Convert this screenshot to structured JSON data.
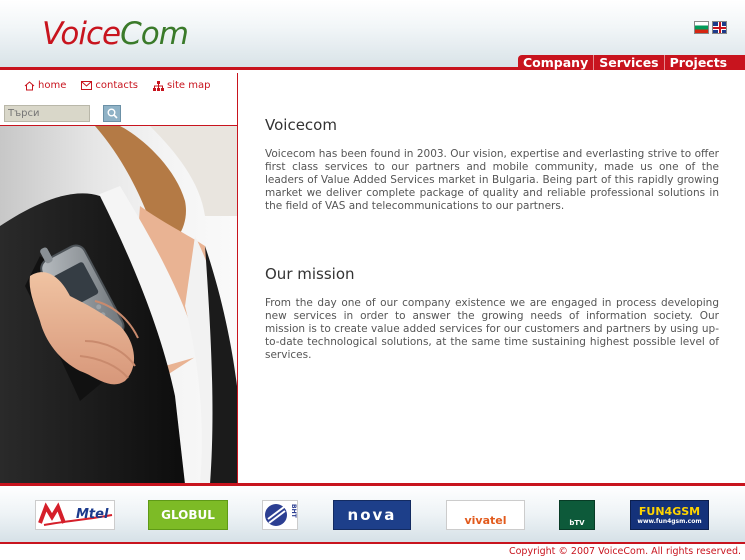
{
  "header": {
    "logo_part1": "Voice",
    "logo_part2": "Com",
    "nav": [
      "Company",
      "Services",
      "Projects"
    ]
  },
  "quicklinks": {
    "home": "home",
    "contacts": "contacts",
    "sitemap": "site map"
  },
  "search": {
    "placeholder": "Търси"
  },
  "content": {
    "title1": "Voicecom",
    "text1": "Voicecom has been found in 2003. Our vision, expertise and everlasting strive to offer first class services to our partners and mobile community, made us one of the leaders of Value Added Services market in Bulgaria. Being part of this rapidly growing market we deliver complete package of quality and reliable professional solutions in the field of VAS and telecommunications to our partners.",
    "title2": "Our mission",
    "text2": "From the day one of our company existence we are engaged in process developing new services in order to answer the growing needs of information society. Our mission is to create value added services for our customers and partners by using up-to-date technological solutions, at the same time sustaining highest possible level of services."
  },
  "partners": [
    "Mtel",
    "GLOBUL",
    "BHT",
    "nova",
    "vivatel",
    "bTV",
    "FUN4GSM",
    "www.fun4gsm.com"
  ],
  "footer": {
    "copyright": "Copyright © 2007 VoiceCom. All rights reserved."
  },
  "colors": {
    "accent": "#c8141e",
    "logo_green": "#3a7a2a"
  }
}
